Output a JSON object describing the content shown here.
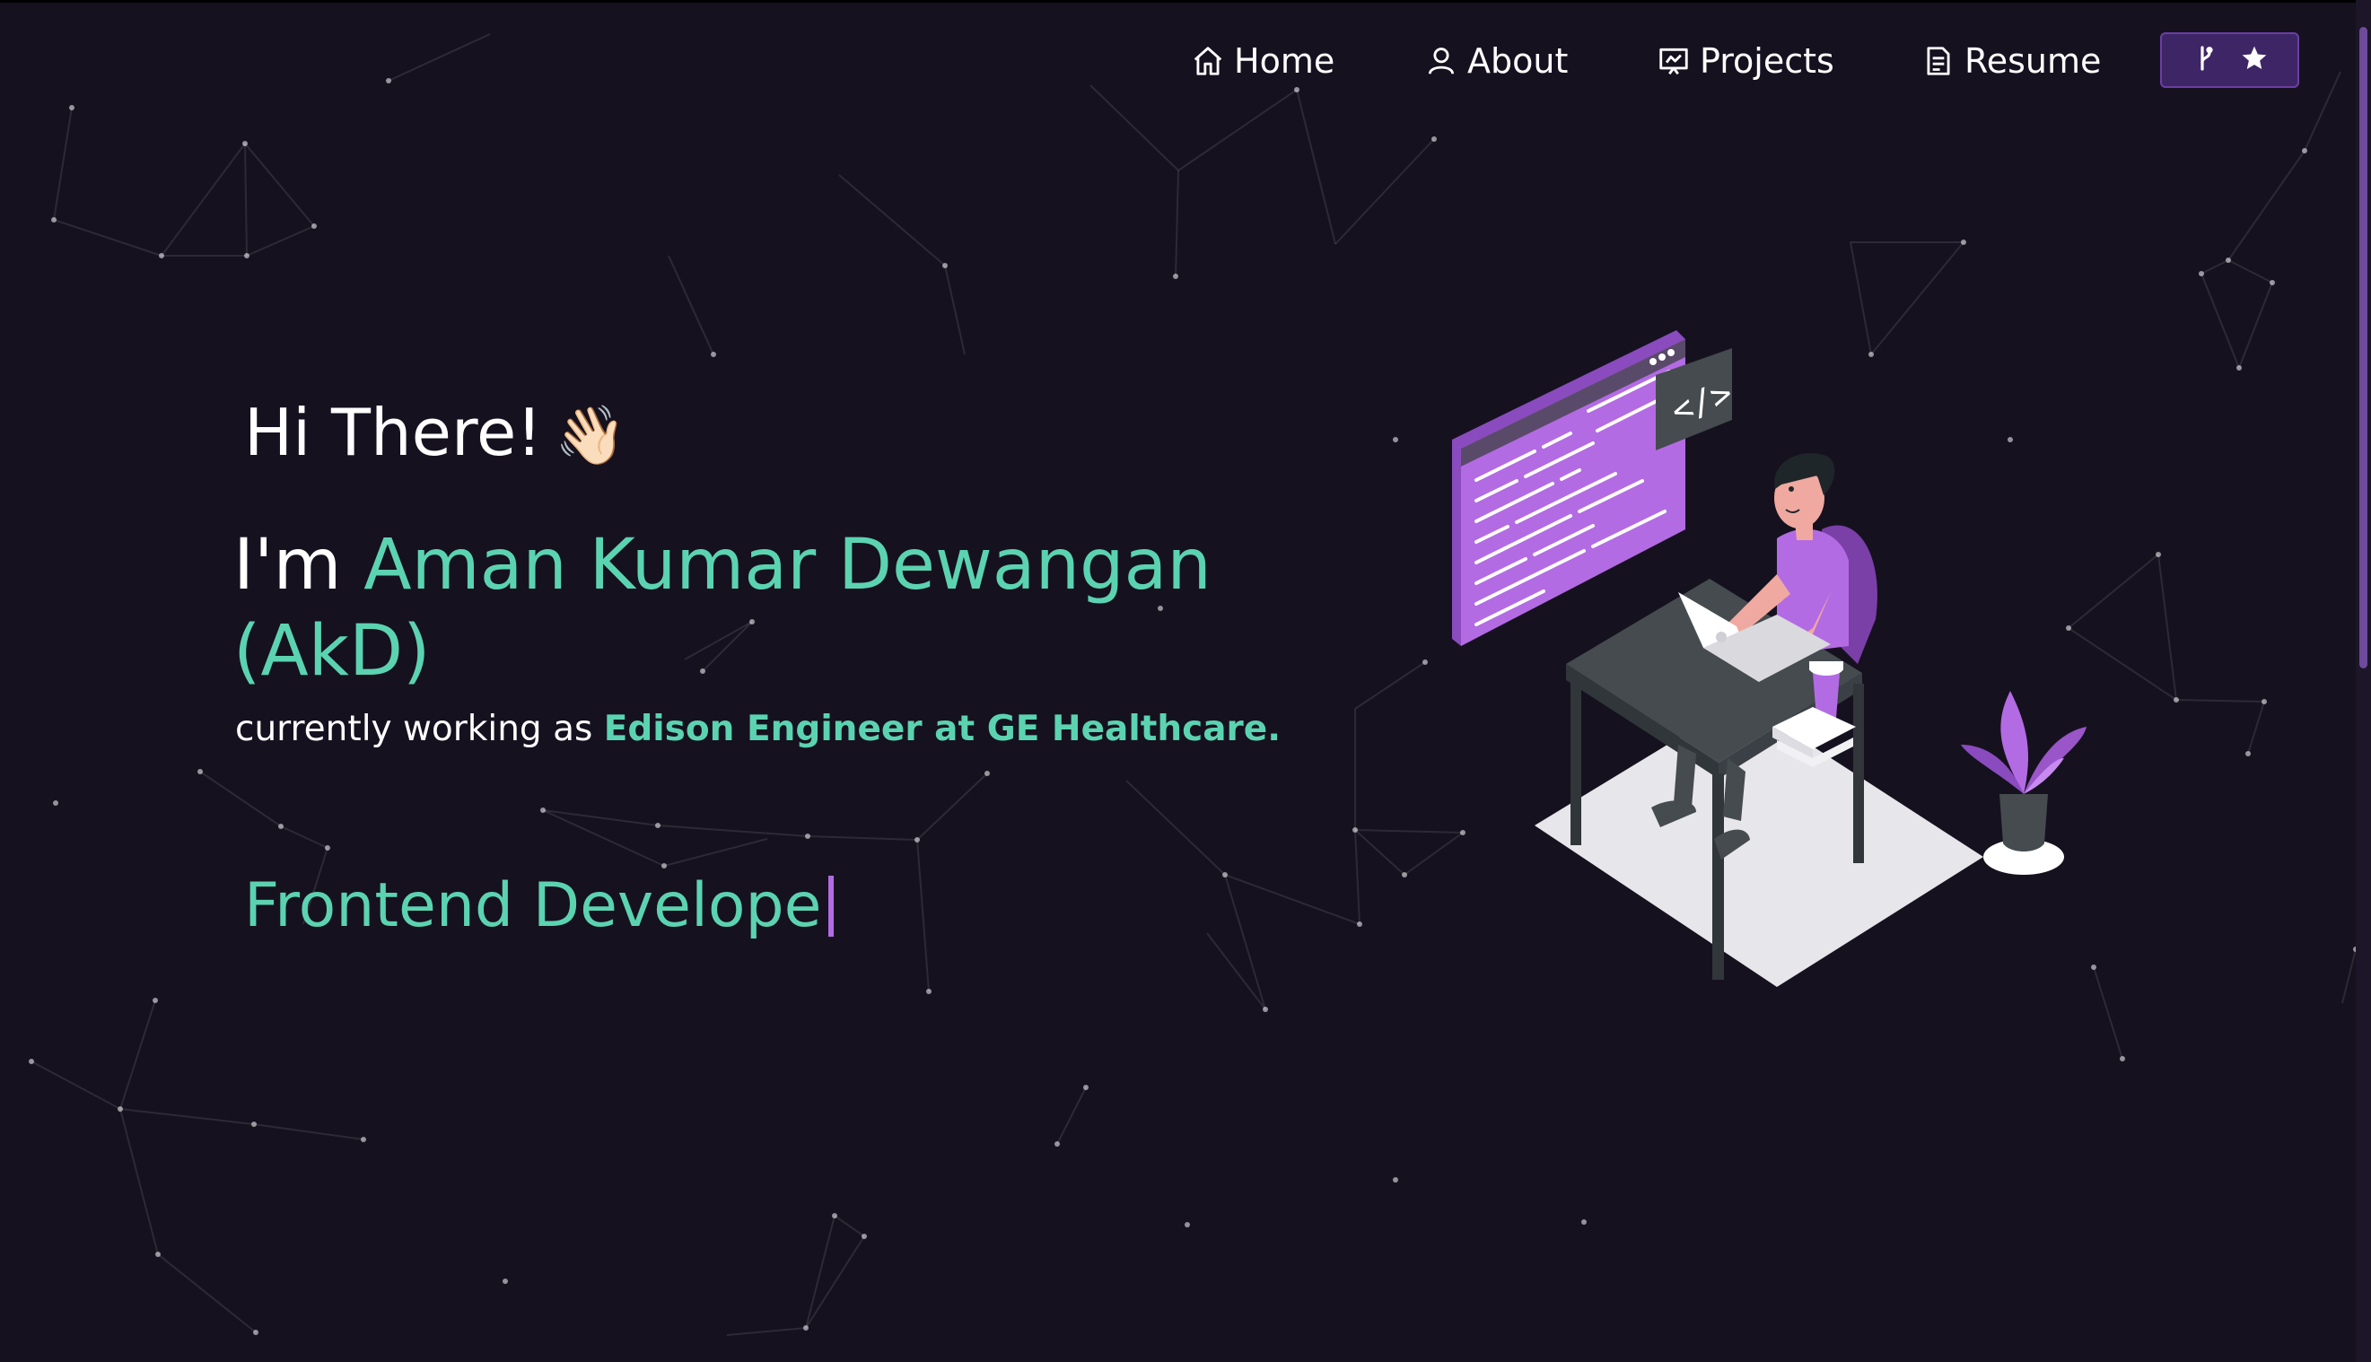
{
  "nav": {
    "items": [
      {
        "label": "Home",
        "icon": "home-icon"
      },
      {
        "label": "About",
        "icon": "user-icon"
      },
      {
        "label": "Projects",
        "icon": "presentation-icon"
      },
      {
        "label": "Resume",
        "icon": "document-icon"
      }
    ],
    "github_button": {
      "icons": [
        "fork-icon",
        "star-icon"
      ]
    }
  },
  "hero": {
    "greeting": "Hi There!",
    "wave_emoji": "👋🏻",
    "name_prefix": "I'm",
    "name": "Aman Kumar Dewangan (AkD)",
    "subtitle_prefix": "currently working as",
    "subtitle_role": "Edison Engineer at GE Healthcare.",
    "typewriter_text": "Frontend Develope"
  },
  "colors": {
    "background": "#16111f",
    "accent": "#5bd3b1",
    "purple": "#b36be3",
    "button_bg": "#3e2566"
  }
}
